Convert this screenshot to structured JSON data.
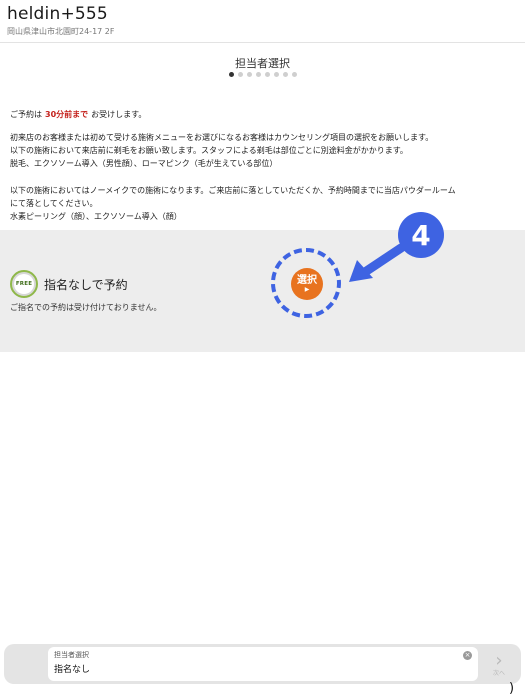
{
  "header": {
    "shop_name": "heldin+555",
    "address": "岡山県津山市北園町24-17 2F"
  },
  "step": {
    "title": "担当者選択",
    "total": 8,
    "current": 1
  },
  "notice": {
    "reserve_prefix": "ご予約は",
    "reserve_highlight": "30分前まで",
    "reserve_suffix": "お受けします。",
    "paragraph1": [
      "初来店のお客様または初めて受ける施術メニューをお選びになるお客様はカウンセリング項目の選択をお願いします。",
      "以下の施術において来店前に剃毛をお願い致します。スタッフによる剃毛は部位ごとに別途料金がかかります。",
      "脱毛、エクソソーム導入（男性顔）、ローマピンク（毛が生えている部位）"
    ],
    "paragraph2": [
      "以下の施術においてはノーメイクでの施術になります。ご来店前に落としていただくか、予約時間までに当店パウダールーム",
      "にて落としてください。",
      "水素ピーリング（顔）、エクソソーム導入（顔）"
    ]
  },
  "option": {
    "badge": "FREE",
    "title": "指名なしで予約",
    "note": "ご指名での予約は受け付けておりません。",
    "select_label": "選択",
    "select_arrow": "▶"
  },
  "callout": {
    "number": "4",
    "color": "#3e63e2"
  },
  "bottom_bar": {
    "field_label": "担当者選択",
    "field_value": "指名なし",
    "clear_icon": "×",
    "next_label": "次へ",
    "next_icon": "›"
  },
  "colors": {
    "accent": "#e8731f",
    "highlight": "#c4211c",
    "badge_ring": "#8fb84a"
  }
}
